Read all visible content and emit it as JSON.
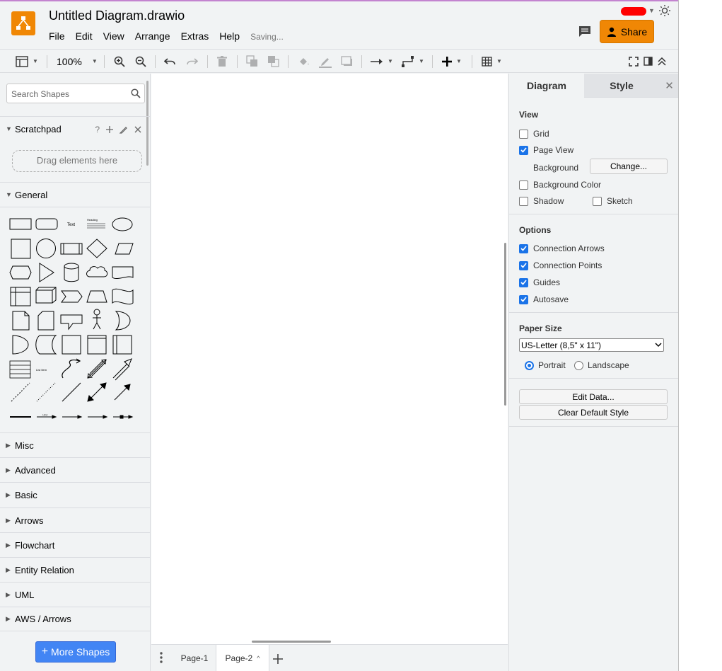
{
  "header": {
    "title": "Untitled Diagram.drawio",
    "menu": [
      "File",
      "Edit",
      "View",
      "Arrange",
      "Extras",
      "Help"
    ],
    "status": "Saving...",
    "share_label": "Share"
  },
  "toolbar": {
    "zoom": "100%"
  },
  "sidebar": {
    "search_placeholder": "Search Shapes",
    "scratchpad": {
      "title": "Scratchpad",
      "help": "?",
      "drop_hint": "Drag elements here"
    },
    "general_title": "General",
    "sections": [
      "Misc",
      "Advanced",
      "Basic",
      "Arrows",
      "Flowchart",
      "Entity Relation",
      "UML",
      "AWS / Arrows"
    ],
    "more_shapes_label": "More Shapes"
  },
  "pages": {
    "tabs": [
      "Page-1",
      "Page-2"
    ],
    "active": "Page-2"
  },
  "format_panel": {
    "tabs": [
      "Diagram",
      "Style"
    ],
    "view": {
      "title": "View",
      "grid": {
        "label": "Grid",
        "checked": false
      },
      "page_view": {
        "label": "Page View",
        "checked": true
      },
      "background_label": "Background",
      "change_button": "Change...",
      "background_color": {
        "label": "Background Color",
        "checked": false
      },
      "shadow": {
        "label": "Shadow",
        "checked": false
      },
      "sketch": {
        "label": "Sketch",
        "checked": false
      }
    },
    "options": {
      "title": "Options",
      "connection_arrows": {
        "label": "Connection Arrows",
        "checked": true
      },
      "connection_points": {
        "label": "Connection Points",
        "checked": true
      },
      "guides": {
        "label": "Guides",
        "checked": true
      },
      "autosave": {
        "label": "Autosave",
        "checked": true
      }
    },
    "paper": {
      "title": "Paper Size",
      "size": "US-Letter (8,5\" x 11\")",
      "portrait": "Portrait",
      "landscape": "Landscape",
      "orientation": "Portrait"
    },
    "edit_data": "Edit Data...",
    "clear_style": "Clear Default Style"
  },
  "colors": {
    "accent": "#f08705",
    "primary": "#4285f4",
    "check": "#1a73e8"
  }
}
